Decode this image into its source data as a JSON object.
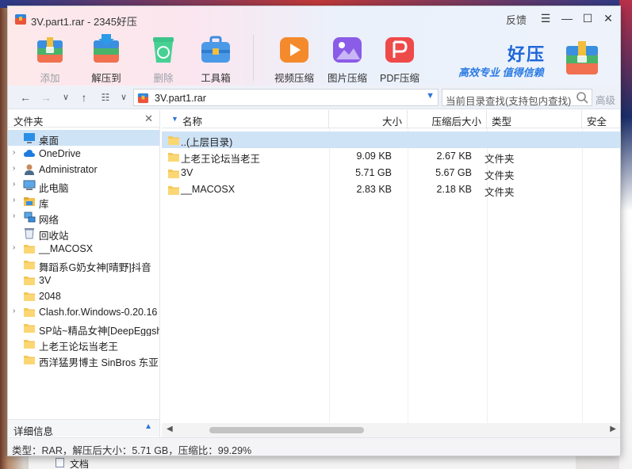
{
  "window": {
    "title": "3V.part1.rar - 2345好压",
    "feedback": "反馈"
  },
  "toolbar": {
    "items": [
      {
        "label": "添加",
        "icon": "add-archive-icon",
        "disabled": true
      },
      {
        "label": "解压到",
        "icon": "extract-archive-icon",
        "disabled": false
      },
      {
        "label": "删除",
        "icon": "recycle-delete-icon",
        "disabled": true
      },
      {
        "label": "工具箱",
        "icon": "toolbox-icon",
        "disabled": false
      },
      {
        "label": "视频压缩",
        "icon": "video-compress-icon",
        "disabled": false
      },
      {
        "label": "图片压缩",
        "icon": "image-compress-icon",
        "disabled": false
      },
      {
        "label": "PDF压缩",
        "icon": "pdf-compress-icon",
        "disabled": false
      }
    ]
  },
  "brand": {
    "name": "好压",
    "slogan": "高效专业  值得信赖"
  },
  "nav": {
    "address": "3V.part1.rar",
    "search_placeholder": "当前目录查找(支持包内查找)",
    "advanced": "高级"
  },
  "sidebar": {
    "header": "文件夹",
    "items": [
      {
        "label": "桌面",
        "icon": "desktop-icon",
        "expandable": false,
        "selected": true
      },
      {
        "label": "OneDrive",
        "icon": "cloud-icon",
        "expandable": true
      },
      {
        "label": "Administrator",
        "icon": "user-icon",
        "expandable": true
      },
      {
        "label": "此电脑",
        "icon": "computer-icon",
        "expandable": true
      },
      {
        "label": "库",
        "icon": "library-icon",
        "expandable": true
      },
      {
        "label": "网络",
        "icon": "network-icon",
        "expandable": true
      },
      {
        "label": "回收站",
        "icon": "recycle-bin-icon",
        "expandable": false
      },
      {
        "label": "__MACOSX",
        "icon": "folder-icon",
        "expandable": true
      },
      {
        "label": "舞蹈系G奶女神[晴野]抖音",
        "icon": "folder-icon",
        "expandable": false
      },
      {
        "label": "3V",
        "icon": "folder-icon",
        "expandable": false
      },
      {
        "label": "2048",
        "icon": "folder-icon",
        "expandable": false
      },
      {
        "label": "Clash.for.Windows-0.20.16",
        "icon": "folder-icon",
        "expandable": true
      },
      {
        "label": "SP站~精品女神[DeepEggsh",
        "icon": "folder-icon",
        "expandable": false
      },
      {
        "label": "上老王论坛当老王",
        "icon": "folder-icon",
        "expandable": false
      },
      {
        "label": "西洋猛男博主 SinBros 东亚",
        "icon": "folder-icon",
        "expandable": false
      }
    ],
    "details": "详细信息"
  },
  "filelist": {
    "columns": {
      "name": "名称",
      "size": "大小",
      "packed": "压缩后大小",
      "type": "类型",
      "security": "安全"
    },
    "rows": [
      {
        "name": "..(上层目录)",
        "size": "",
        "packed": "",
        "type": ""
      },
      {
        "name": "上老王论坛当老王",
        "size": "9.09 KB",
        "packed": "2.67 KB",
        "type": "文件夹"
      },
      {
        "name": "3V",
        "size": "5.71 GB",
        "packed": "5.67 GB",
        "type": "文件夹"
      },
      {
        "name": "__MACOSX",
        "size": "2.83 KB",
        "packed": "2.18 KB",
        "type": "文件夹"
      }
    ]
  },
  "status": {
    "text": "类型：RAR，解压后大小：5.71 GB，压缩比：99.29%"
  },
  "background": {
    "taskbar_text": "文档"
  }
}
